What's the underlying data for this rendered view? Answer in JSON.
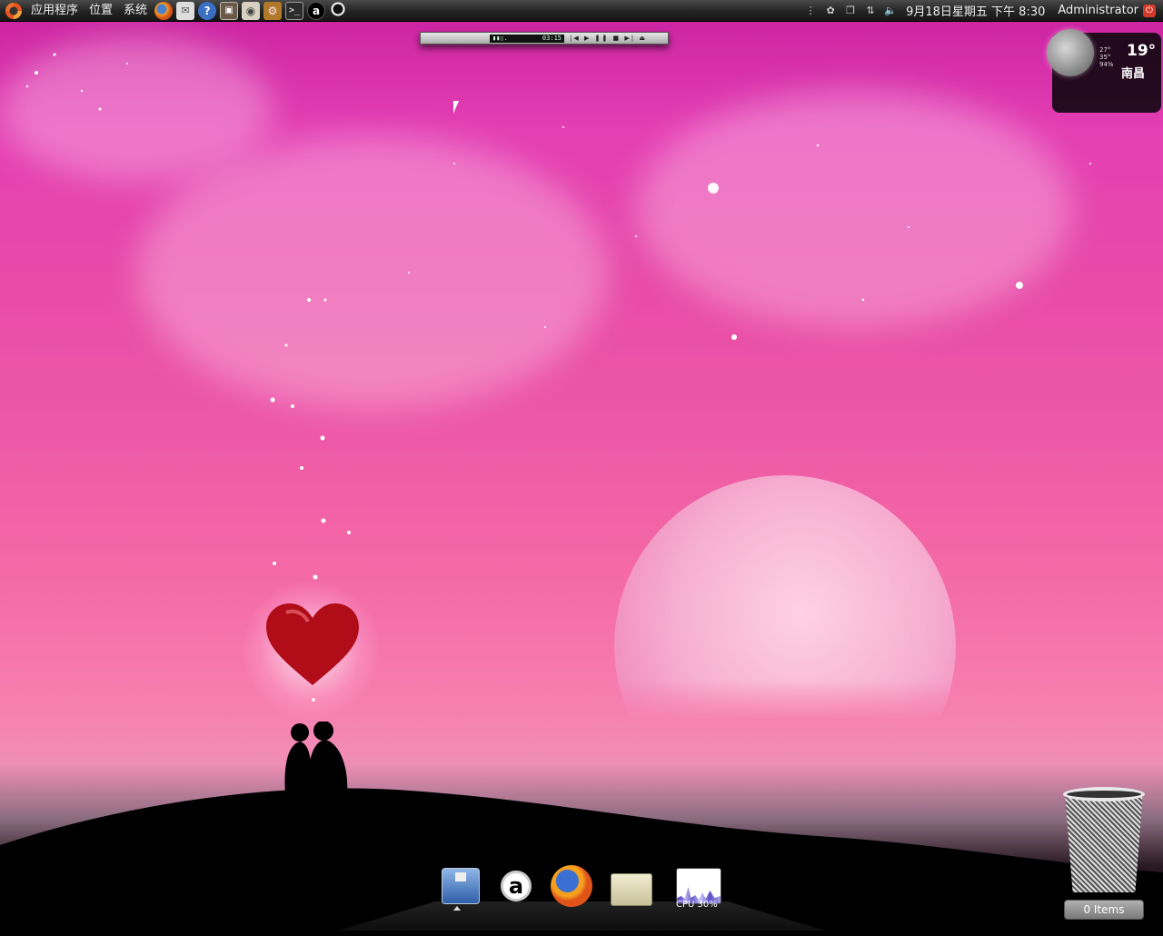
{
  "top_panel": {
    "menus": [
      "应用程序",
      "位置",
      "系统"
    ],
    "clock": "9月18日星期五 下午 8:30",
    "user": "Administrator",
    "launchers": [
      "firefox-icon",
      "mail-icon",
      "help-icon",
      "screenshot-icon",
      "camera-icon",
      "settings-icon",
      "terminal-icon",
      "amule-icon",
      "qq-icon"
    ]
  },
  "mini_player": {
    "time": "03:15"
  },
  "weather": {
    "temperature": "19°",
    "high": "27°",
    "low": "35°",
    "humidity": "94%",
    "city": "南昌"
  },
  "dock": {
    "items": [
      "save-icon",
      "amule-icon",
      "firefox-icon",
      "folder-icon",
      "cpu-monitor-icon"
    ],
    "cpu_label": "CPU 30%"
  },
  "trash": {
    "label": "0 Items"
  }
}
